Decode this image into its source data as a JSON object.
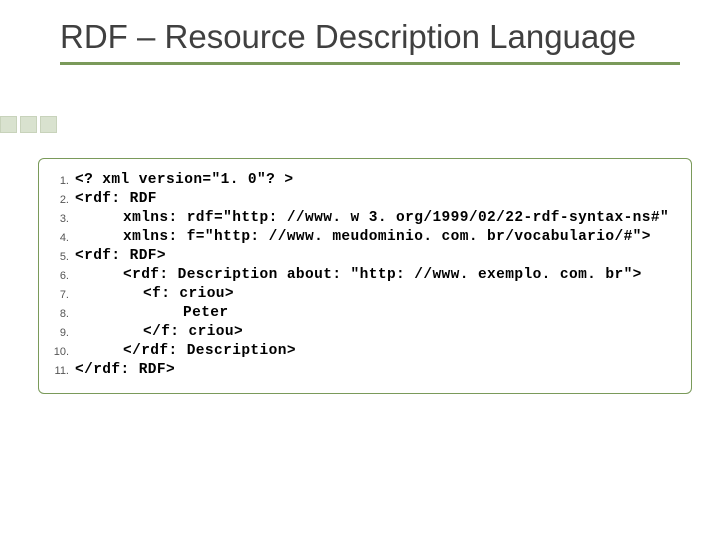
{
  "title": "RDF – Resource Description Language",
  "code": {
    "lines": [
      {
        "n": "1.",
        "indent": "",
        "text": "<? xml version=\"1. 0\"? >"
      },
      {
        "n": "2.",
        "indent": "",
        "text": "<rdf: RDF"
      },
      {
        "n": "3.",
        "indent": "ind1",
        "text": "xmlns: rdf=\"http: //www. w 3. org/1999/02/22-rdf-syntax-ns#\""
      },
      {
        "n": "4.",
        "indent": "ind1",
        "text": "xmlns: f=\"http: //www. meudominio. com. br/vocabulario/#\">"
      },
      {
        "n": "5.",
        "indent": "",
        "text": "<rdf: RDF>"
      },
      {
        "n": "6.",
        "indent": "ind1",
        "text": "<rdf: Description about: \"http: //www. exemplo. com. br\">"
      },
      {
        "n": "7.",
        "indent": "ind2",
        "text": "<f: criou>"
      },
      {
        "n": "8.",
        "indent": "ind3",
        "text": "Peter"
      },
      {
        "n": "9.",
        "indent": "ind2",
        "text": "</f: criou>"
      },
      {
        "n": "10.",
        "indent": "ind1",
        "text": "</rdf: Description>"
      },
      {
        "n": "11.",
        "indent": "",
        "text": "</rdf: RDF>"
      }
    ]
  }
}
